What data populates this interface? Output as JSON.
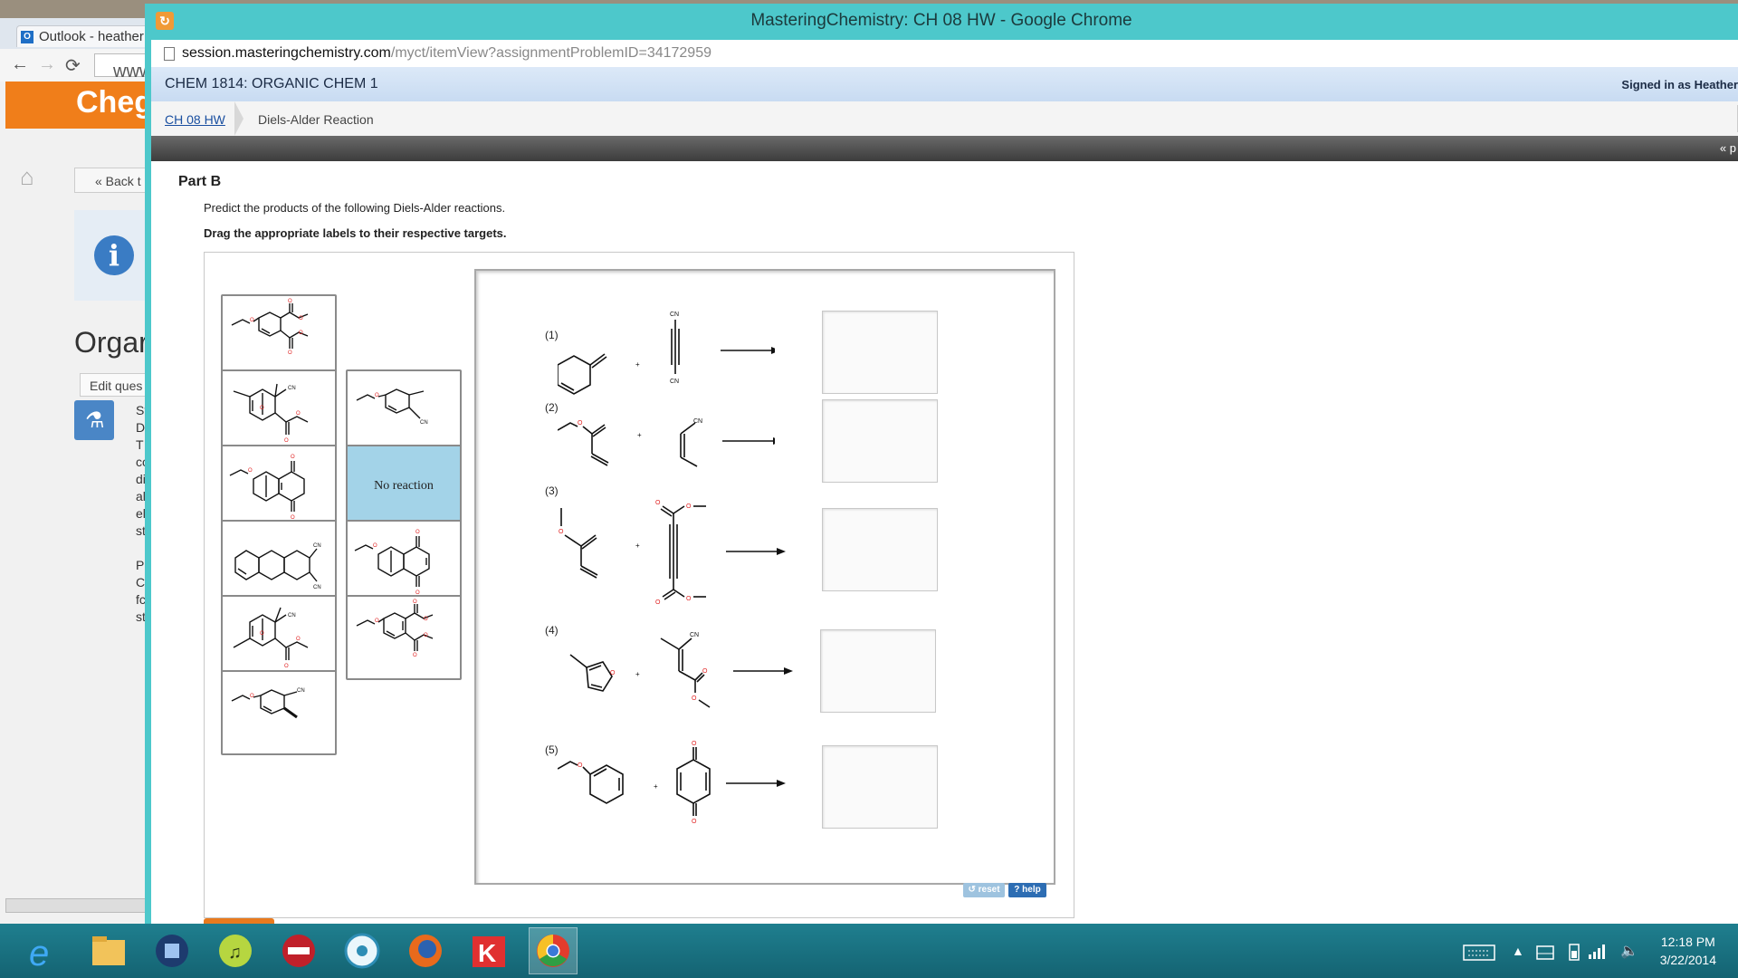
{
  "background_window": {
    "tab_title": "Outlook - heather",
    "url_text": "www",
    "brand": "Cheg",
    "back_label": "« Back t",
    "heading": "Orgar",
    "edit_label": "Edit ques",
    "fragments": [
      "St",
      "D",
      "T",
      "cc",
      "di",
      "al",
      "el",
      "st",
      "",
      "P",
      "C",
      "fc",
      "st"
    ]
  },
  "window": {
    "title": "MasteringChemistry: CH 08 HW - Google Chrome",
    "url_host": "session.masteringchemistry.com",
    "url_path": "/myct/itemView?assignmentProblemID=34172959",
    "course": "CHEM 1814: ORGANIC CHEM 1",
    "signed_in": "Signed in as Heather",
    "breadcrumb": [
      "CH 08 HW",
      "Diels-Alder Reaction"
    ],
    "pager": "« p"
  },
  "problem": {
    "part": "Part B",
    "prompt": "Predict the products of the following Diels-Alder reactions.",
    "instruction": "Drag the appropriate labels to their respective targets.",
    "no_reaction_label": "No reaction",
    "reaction_numbers": [
      "(1)",
      "(2)",
      "(3)",
      "(4)",
      "(5)"
    ],
    "chem_labels": {
      "cn": "CN",
      "o": "O",
      "plus": "+"
    },
    "reset_label": "reset",
    "help_label": "? help"
  },
  "taskbar": {
    "time": "12:18 PM",
    "date": "3/22/2014"
  },
  "colors": {
    "chrome_frame": "#4dc8cb",
    "course_bar": "#c8dbf2",
    "no_reaction_bg": "#a3d3e8",
    "oxygen_red": "#e02020",
    "taskbar": "#1b7484"
  }
}
